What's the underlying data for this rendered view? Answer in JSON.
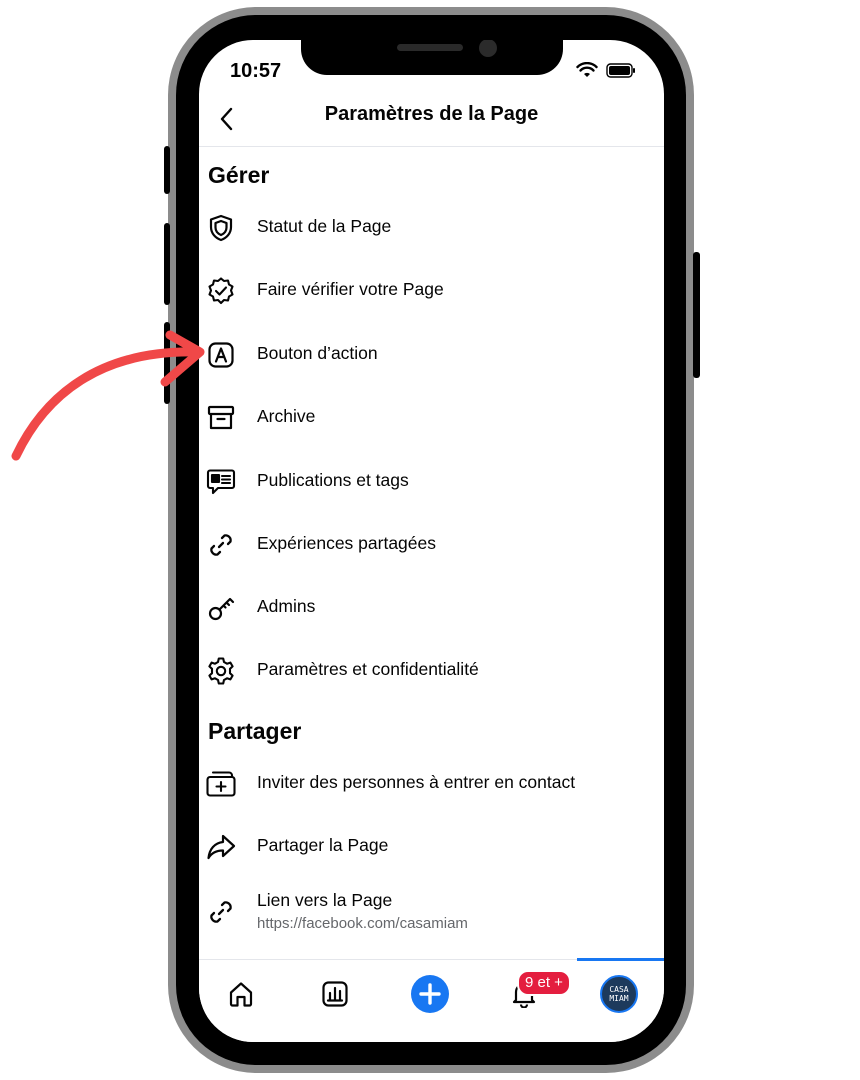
{
  "status_bar": {
    "time": "10:57"
  },
  "header": {
    "title": "Paramètres de la Page"
  },
  "sections": {
    "manage": {
      "title": "Gérer",
      "items": [
        {
          "label": "Statut de la Page",
          "icon": "shield-icon"
        },
        {
          "label": "Faire vérifier votre Page",
          "icon": "verified-badge-icon"
        },
        {
          "label": "Bouton d’action",
          "icon": "action-button-icon"
        },
        {
          "label": "Archive",
          "icon": "archive-icon"
        },
        {
          "label": "Publications et tags",
          "icon": "publications-icon"
        },
        {
          "label": "Expériences partagées",
          "icon": "link-icon"
        },
        {
          "label": "Admins",
          "icon": "key-icon"
        },
        {
          "label": "Paramètres et confidentialité",
          "icon": "gear-icon"
        }
      ]
    },
    "share": {
      "title": "Partager",
      "items": [
        {
          "label": "Inviter des personnes à entrer en contact",
          "icon": "invite-icon"
        },
        {
          "label": "Partager la Page",
          "icon": "share-icon"
        },
        {
          "label": "Lien vers la Page",
          "sublabel": "https://facebook.com/casamiam",
          "icon": "link-icon"
        }
      ]
    }
  },
  "tabbar": {
    "notifications_badge": "9 et +",
    "avatar_text": "CASA MIAM"
  },
  "colors": {
    "accent": "#1877f2",
    "badge": "#e41e3f",
    "annotation_arrow": "#f04848"
  }
}
